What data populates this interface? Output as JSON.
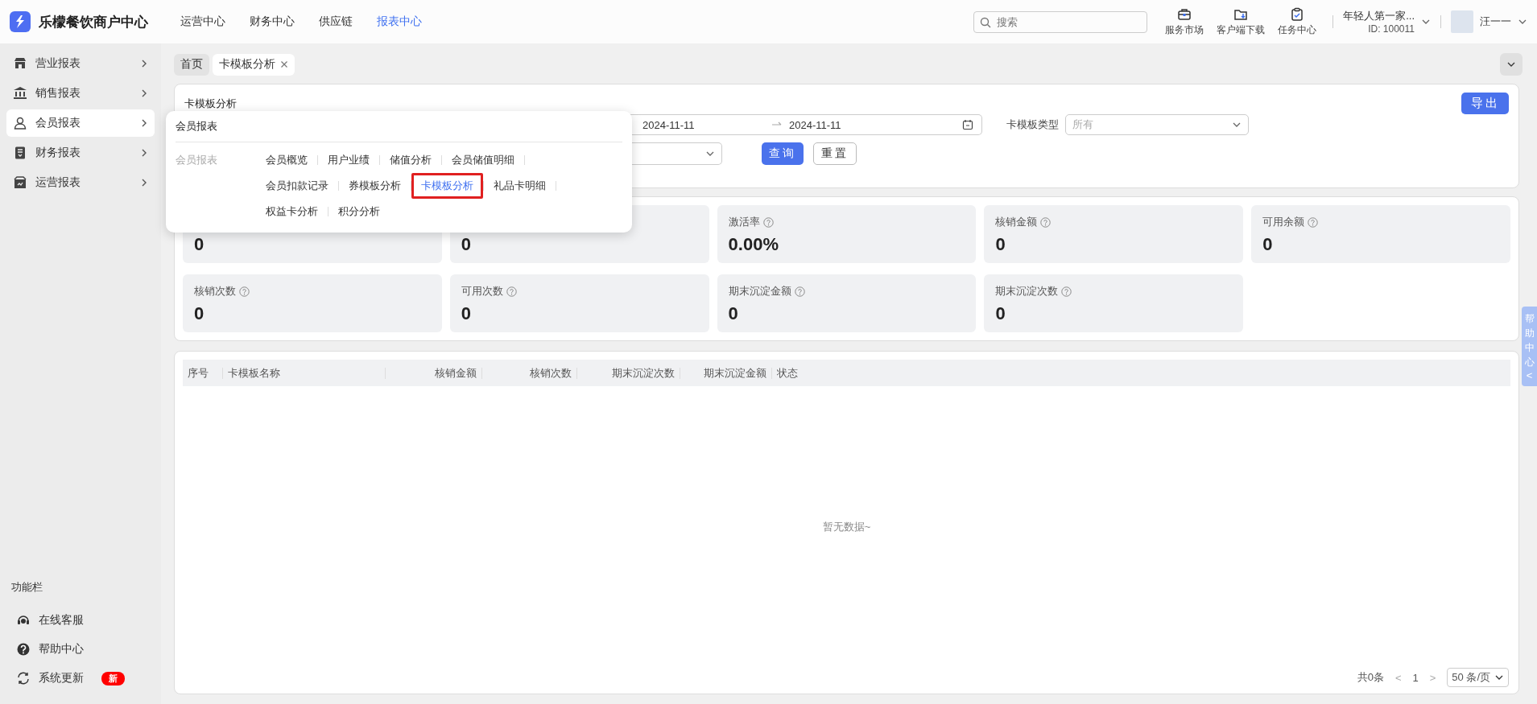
{
  "header": {
    "logo_text": "乐檬餐饮商户中心",
    "nav": [
      {
        "label": "运营中心",
        "selected": false
      },
      {
        "label": "财务中心",
        "selected": false
      },
      {
        "label": "供应链",
        "selected": false
      },
      {
        "label": "报表中心",
        "selected": true
      }
    ],
    "search": {
      "placeholder": "搜索"
    },
    "shortcuts": [
      {
        "label": "服务市场",
        "kind": "briefcase"
      },
      {
        "label": "客户端下载",
        "kind": "download"
      },
      {
        "label": "任务中心",
        "kind": "clipboard"
      }
    ],
    "store": {
      "name": "年轻人第一家...",
      "id": "ID: 100011"
    },
    "user": {
      "name": "汪一一"
    }
  },
  "sidebar": {
    "items": [
      {
        "label": "营业报表",
        "kind": "store",
        "selected": false
      },
      {
        "label": "销售报表",
        "kind": "bank",
        "selected": false
      },
      {
        "label": "会员报表",
        "kind": "person",
        "selected": true
      },
      {
        "label": "财务报表",
        "kind": "ledger",
        "selected": false
      },
      {
        "label": "运营报表",
        "kind": "box",
        "selected": false
      }
    ],
    "footer_title": "功能栏",
    "footer_items": [
      {
        "label": "在线客服",
        "kind": "headset"
      },
      {
        "label": "帮助中心",
        "kind": "help"
      },
      {
        "label": "系统更新",
        "kind": "refresh",
        "badge": "新"
      }
    ]
  },
  "tabs": [
    {
      "label": "首页",
      "selected": false,
      "closable": false
    },
    {
      "label": "卡模板分析",
      "selected": true,
      "closable": true
    }
  ],
  "filter": {
    "title": "卡模板分析",
    "export": "导出",
    "date_range": {
      "start": "2024-11-11",
      "end": "2024-11-11"
    },
    "card_type": {
      "label": "卡模板类型",
      "placeholder": "所有"
    },
    "buttons": [
      {
        "label": "查询",
        "kind": "primary"
      },
      {
        "label": "重置",
        "kind": "default"
      }
    ]
  },
  "stats": [
    {
      "value": "0"
    },
    {
      "value": "0"
    },
    {
      "label": "激活率",
      "value": "0.00%"
    },
    {
      "label": "核销金额",
      "value": "0"
    },
    {
      "label": "可用余额",
      "value": "0"
    },
    {
      "label": "核销次数",
      "value": "0"
    },
    {
      "label": "可用次数",
      "value": "0"
    },
    {
      "label": "期末沉淀金额",
      "value": "0"
    },
    {
      "label": "期末沉淀次数",
      "value": "0"
    }
  ],
  "table": {
    "columns": [
      {
        "label": "序号"
      },
      {
        "label": "卡模板名称"
      },
      {
        "label": "核销金额"
      },
      {
        "label": "核销次数"
      },
      {
        "label": "期末沉淀次数"
      },
      {
        "label": "期末沉淀金额"
      },
      {
        "label": "状态"
      }
    ],
    "empty_text": "暂无数据~",
    "pagination": {
      "total": "共0条",
      "prev": "<",
      "page": "1",
      "next": ">",
      "page_size": "50 条/页"
    }
  },
  "menu": {
    "title": "会员报表",
    "groups": [
      {
        "label": "会员报表",
        "items": [
          {
            "label": "会员概览",
            "selected": false,
            "highlighted": false
          },
          {
            "label": "用户业绩",
            "selected": false,
            "highlighted": false
          },
          {
            "label": "储值分析",
            "selected": false,
            "highlighted": false
          },
          {
            "label": "会员储值明细",
            "selected": false,
            "highlighted": false
          },
          {
            "label": "会员扣款记录",
            "selected": false,
            "highlighted": false
          },
          {
            "label": "券模板分析",
            "selected": false,
            "highlighted": false
          },
          {
            "label": "卡模板分析",
            "selected": true,
            "highlighted": true
          },
          {
            "label": "礼品卡明细",
            "selected": false,
            "highlighted": false
          },
          {
            "label": "权益卡分析",
            "selected": false,
            "highlighted": false
          },
          {
            "label": "积分分析",
            "selected": false,
            "highlighted": false
          }
        ]
      }
    ]
  },
  "help_tab": {
    "label": "帮助中心",
    "arrow": "<"
  }
}
